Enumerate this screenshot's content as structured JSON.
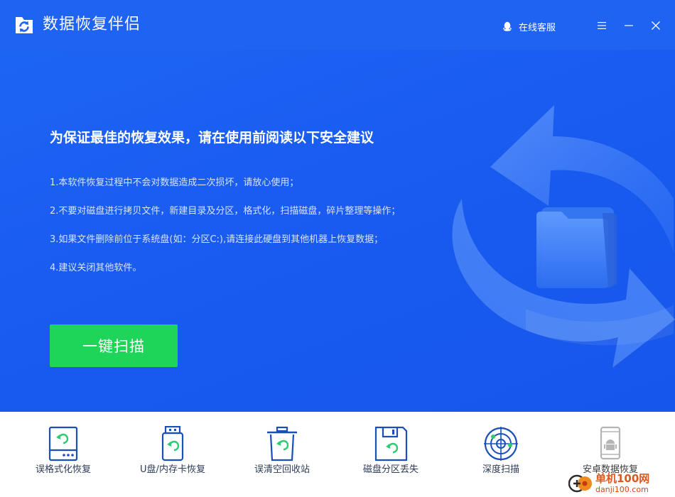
{
  "window": {
    "title": "数据恢复伴侣",
    "support_label": "在线客服"
  },
  "hero": {
    "headline": "为保证最佳的恢复效果，请在使用前阅读以下安全建议",
    "tips": [
      "1.本软件恢复过程中不会对数据造成二次损坏，请放心使用；",
      "2.不要对磁盘进行拷贝文件，新建目录及分区，格式化，扫描磁盘，碎片整理等操作；",
      "3.如果文件删除前位于系统盘(如：分区C:),请连接此硬盘到其他机器上恢复数据；",
      "4.建议关闭其他软件。"
    ],
    "scan_button": "一键扫描"
  },
  "modes": [
    {
      "label": "误格式化恢复",
      "icon": "formatted-drive-icon"
    },
    {
      "label": "U盘/内存卡恢复",
      "icon": "usb-drive-icon"
    },
    {
      "label": "误清空回收站",
      "icon": "recycle-bin-icon"
    },
    {
      "label": "磁盘分区丢失",
      "icon": "partition-floppy-icon"
    },
    {
      "label": "深度扫描",
      "icon": "radar-scan-icon"
    },
    {
      "label": "安卓数据恢复",
      "icon": "android-phone-icon"
    }
  ],
  "watermark": {
    "name": "单机100网",
    "url": "danji100.com"
  },
  "colors": {
    "primary_blue": "#1f63f2",
    "scan_green": "#1ed55a",
    "icon_navy": "#1b4fb8",
    "icon_green": "#2ecc71"
  }
}
